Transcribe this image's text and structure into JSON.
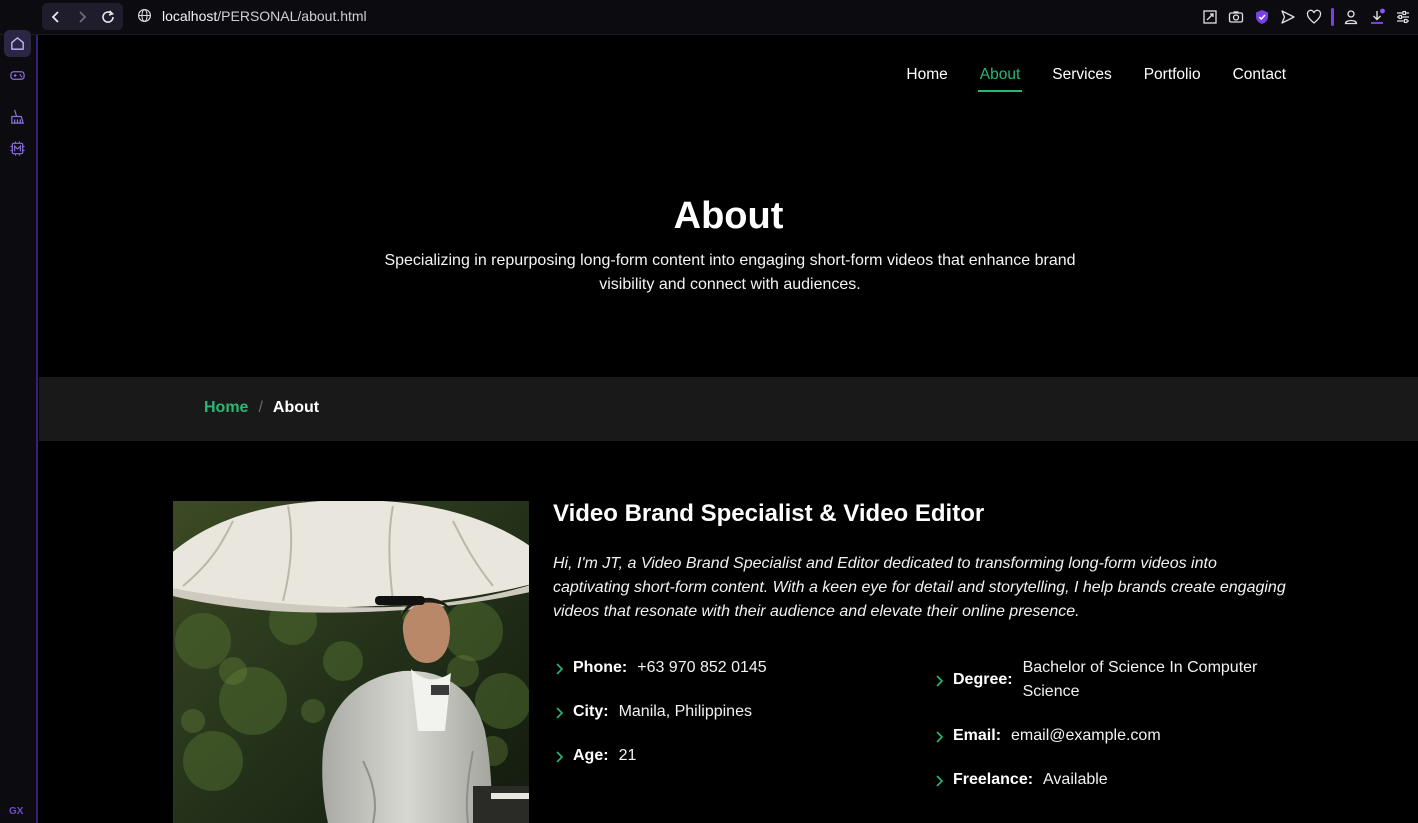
{
  "browser": {
    "url_host": "localhost",
    "url_path": "/PERSONAL/about.html",
    "sidebar_badge": "GX",
    "accent": "#7b3fe8"
  },
  "nav": {
    "items": [
      {
        "label": "Home"
      },
      {
        "label": "About"
      },
      {
        "label": "Services"
      },
      {
        "label": "Portfolio"
      },
      {
        "label": "Contact"
      }
    ],
    "active_color": "#2bb673"
  },
  "hero": {
    "title": "About",
    "subtitle": "Specializing in repurposing long-form content into engaging short-form videos that enhance brand visibility and connect with audiences."
  },
  "breadcrumb": {
    "home": "Home",
    "separator": "/",
    "current": "About"
  },
  "about": {
    "heading": "Video Brand Specialist & Video Editor",
    "description": "Hi, I'm JT, a Video Brand Specialist and Editor dedicated to transforming long-form videos into captivating short-form content. With a keen eye for detail and storytelling, I help brands create engaging videos that resonate with their audience and elevate their online presence.",
    "left": [
      {
        "label": "Phone:",
        "value": "+63 970 852 0145"
      },
      {
        "label": "City:",
        "value": "Manila, Philippines"
      },
      {
        "label": "Age:",
        "value": "21"
      }
    ],
    "right": [
      {
        "label": "Degree:",
        "value": "Bachelor of Science In Computer Science"
      },
      {
        "label": "Email:",
        "value": "email@example.com"
      },
      {
        "label": "Freelance:",
        "value": "Available"
      }
    ]
  }
}
